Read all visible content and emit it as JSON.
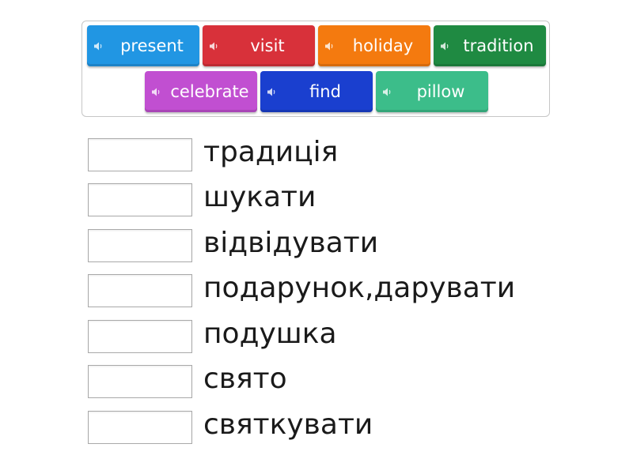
{
  "word_bank": {
    "tiles": [
      {
        "label": "present",
        "color": "#2196e3",
        "icon": "speaker-icon"
      },
      {
        "label": "visit",
        "color": "#d8313a",
        "icon": "speaker-icon"
      },
      {
        "label": "holiday",
        "color": "#f47a0f",
        "icon": "speaker-icon"
      },
      {
        "label": "tradition",
        "color": "#1f8a42",
        "icon": "speaker-icon"
      },
      {
        "label": "celebrate",
        "color": "#c14fd1",
        "icon": "speaker-icon"
      },
      {
        "label": "find",
        "color": "#1a3fcf",
        "icon": "speaker-icon"
      },
      {
        "label": "pillow",
        "color": "#3cbd8a",
        "icon": "speaker-icon"
      }
    ]
  },
  "match_rows": [
    {
      "term": "традиція"
    },
    {
      "term": "шукати"
    },
    {
      "term": "відвідувати"
    },
    {
      "term": "подарунок,дарувати"
    },
    {
      "term": "подушка"
    },
    {
      "term": "свято"
    },
    {
      "term": "святкувати"
    }
  ]
}
